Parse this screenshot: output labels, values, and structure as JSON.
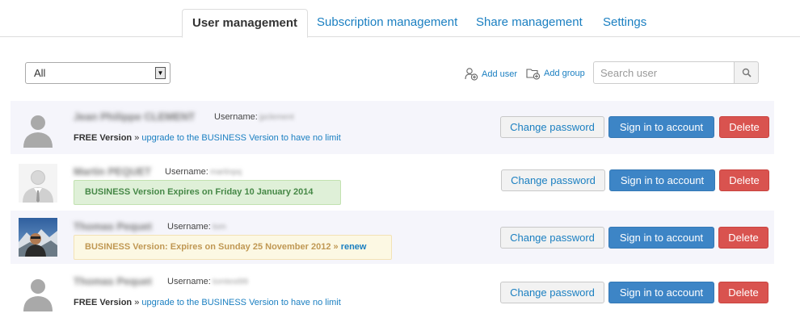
{
  "tabs": [
    {
      "label": "User management",
      "active": true
    },
    {
      "label": "Subscription management",
      "active": false
    },
    {
      "label": "Share management",
      "active": false
    },
    {
      "label": "Settings",
      "active": false
    }
  ],
  "toolbar": {
    "filter_value": "All",
    "add_user_label": "Add user",
    "add_group_label": "Add group",
    "search_placeholder": "Search user"
  },
  "labels": {
    "username": "Username:",
    "change_password": "Change password",
    "sign_in": "Sign in to account",
    "delete": "Delete",
    "free_version": "FREE Version",
    "separator": "»",
    "upgrade_link": "upgrade to the BUSINESS Version to have no limit",
    "renew": "renew"
  },
  "users": [
    {
      "name": "Jean Philippe CLEMENT",
      "username": "jpclement",
      "plan": "FREE Version",
      "avatar": "default-avatar"
    },
    {
      "name": "Martin PEQUET",
      "username": "martinpq",
      "plan_message": "BUSINESS Version Expires on Friday 10 January 2014",
      "avatar": "suit-avatar"
    },
    {
      "name": "Thomas Pequet",
      "username": "tom",
      "plan_message": "BUSINESS Version: Expires on Sunday 25 November 2012 »",
      "avatar": "photo-avatar"
    },
    {
      "name": "Thomas Pequet",
      "username": "tomtest99",
      "plan": "FREE Version",
      "avatar": "default-avatar"
    }
  ],
  "colors": {
    "link": "#1a7fc1",
    "primary": "#3d85c6",
    "danger": "#d9534f",
    "success_bg": "#dff0d8",
    "warning_bg": "#fcf8e3"
  }
}
